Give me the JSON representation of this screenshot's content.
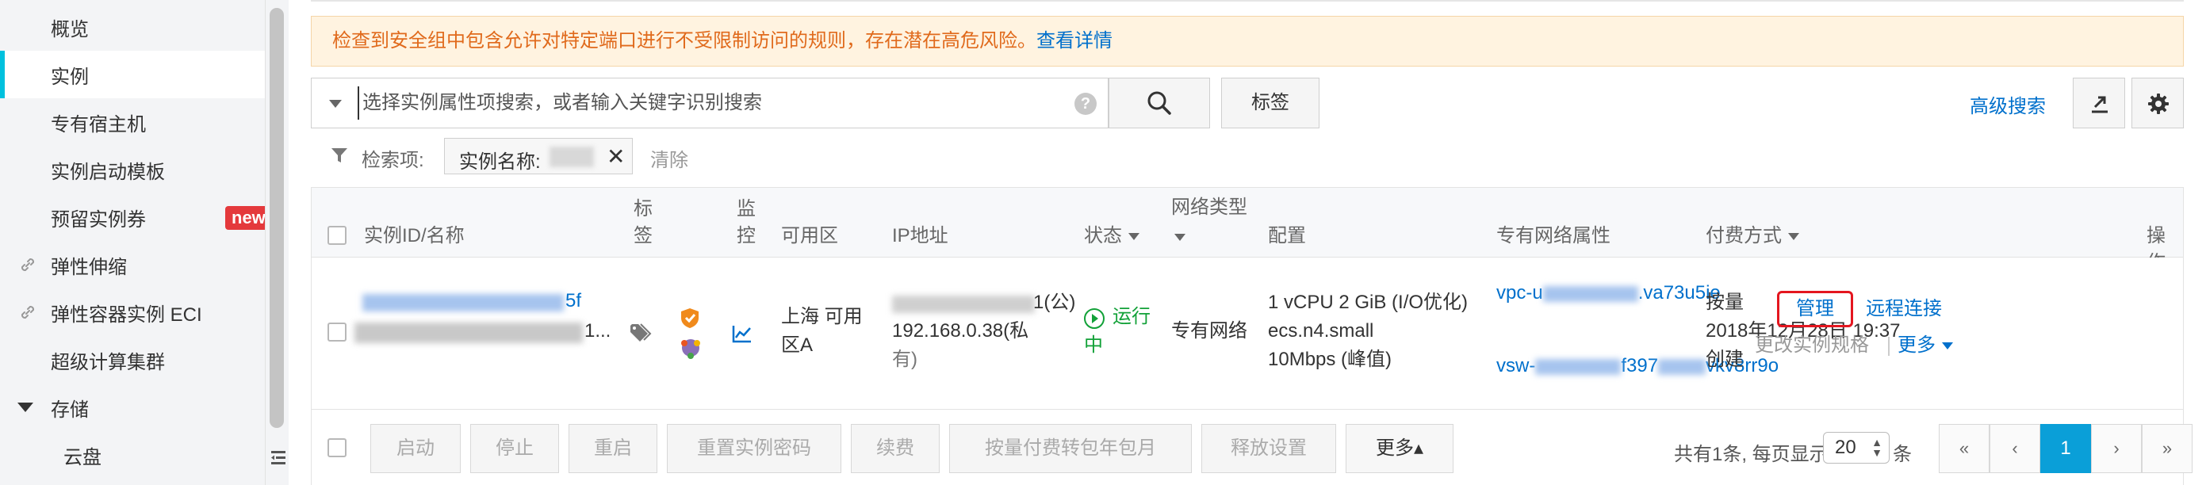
{
  "sidebar": {
    "items": [
      {
        "label": "概览"
      },
      {
        "label": "实例",
        "active": true
      },
      {
        "label": "专有宿主机"
      },
      {
        "label": "实例启动模板"
      },
      {
        "label": "预留实例券",
        "badge": "new"
      },
      {
        "label": "弹性伸缩",
        "icon": "link-icon"
      },
      {
        "label": "弹性容器实例 ECI",
        "icon": "link-icon"
      },
      {
        "label": "超级计算集群"
      },
      {
        "label": "存储",
        "expanded": true
      },
      {
        "label": "云盘"
      }
    ]
  },
  "warning": {
    "text": "检查到安全组中包含允许对特定端口进行不受限制访问的规则，存在潜在高危风险。",
    "link": "查看详情"
  },
  "search": {
    "placeholder": "选择实例属性项搜索，或者输入关键字识别搜索",
    "value": "",
    "help": "?",
    "tag_button": "标签",
    "advanced": "高级搜索"
  },
  "filter": {
    "label": "检索项:",
    "chip": "实例名称:",
    "clear": "清除"
  },
  "table": {
    "headers": {
      "id_name": "实例ID/名称",
      "tag": [
        "标",
        "签"
      ],
      "monitor": [
        "监",
        "控"
      ],
      "zone": "可用区",
      "ip": "IP地址",
      "status": "状态",
      "network_type": "网络类型",
      "config": "配置",
      "vpc": "专有网络属性",
      "billing": "付费方式",
      "actions": "操作"
    },
    "row": {
      "id_suffix": "5f",
      "name_suffix": "1...",
      "zone": [
        "上海 可用",
        "区A"
      ],
      "ip_public_suffix": "1(公)",
      "ip_private": "192.168.0.38(私",
      "ip_private_2": "有)",
      "status": [
        "运行",
        "中"
      ],
      "network_type": "专有网络",
      "config": [
        "1 vCPU 2 GiB (I/O优化)",
        "ecs.n4.small",
        "10Mbps (峰值)"
      ],
      "vpc": "vpc-u",
      "vpc_suffix": ".va73u5ie",
      "vsw": "vsw-",
      "vsw_mid": "f397",
      "vsw_suffix": "vkv8rr9o",
      "billing": [
        "按量",
        "2018年12月28日 19:37",
        "创建"
      ],
      "manage": "管理",
      "remote": "远程连接",
      "change_spec": "更改实例规格",
      "more": "更多"
    }
  },
  "footer": {
    "buttons": [
      "启动",
      "停止",
      "重启",
      "重置实例密码",
      "续费",
      "按量付费转包年包月",
      "释放设置",
      "更多▴"
    ],
    "count": "共有1条, 每页显示:",
    "page_size": "20",
    "unit": "条",
    "pager": [
      "«",
      "‹",
      "1",
      "›",
      "»"
    ]
  },
  "colors": {
    "accent": "#00c1de",
    "link": "#0070cc",
    "warning_text": "#e06a1c",
    "running": "#12a138",
    "page_current": "#0a9fd8",
    "highlight": "#e4161f"
  }
}
